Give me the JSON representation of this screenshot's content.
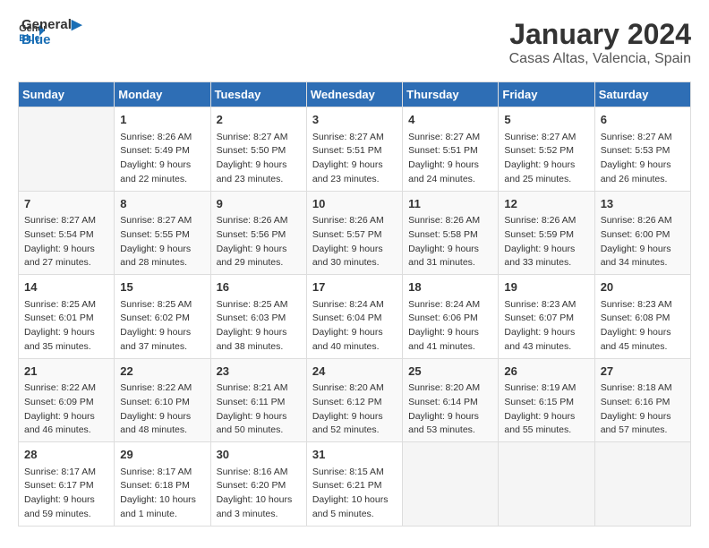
{
  "header": {
    "logo_line1": "General",
    "logo_line2": "Blue",
    "month_year": "January 2024",
    "location": "Casas Altas, Valencia, Spain"
  },
  "weekdays": [
    "Sunday",
    "Monday",
    "Tuesday",
    "Wednesday",
    "Thursday",
    "Friday",
    "Saturday"
  ],
  "weeks": [
    [
      {
        "day": "",
        "info": ""
      },
      {
        "day": "1",
        "info": "Sunrise: 8:26 AM\nSunset: 5:49 PM\nDaylight: 9 hours\nand 22 minutes."
      },
      {
        "day": "2",
        "info": "Sunrise: 8:27 AM\nSunset: 5:50 PM\nDaylight: 9 hours\nand 23 minutes."
      },
      {
        "day": "3",
        "info": "Sunrise: 8:27 AM\nSunset: 5:51 PM\nDaylight: 9 hours\nand 23 minutes."
      },
      {
        "day": "4",
        "info": "Sunrise: 8:27 AM\nSunset: 5:51 PM\nDaylight: 9 hours\nand 24 minutes."
      },
      {
        "day": "5",
        "info": "Sunrise: 8:27 AM\nSunset: 5:52 PM\nDaylight: 9 hours\nand 25 minutes."
      },
      {
        "day": "6",
        "info": "Sunrise: 8:27 AM\nSunset: 5:53 PM\nDaylight: 9 hours\nand 26 minutes."
      }
    ],
    [
      {
        "day": "7",
        "info": "Sunrise: 8:27 AM\nSunset: 5:54 PM\nDaylight: 9 hours\nand 27 minutes."
      },
      {
        "day": "8",
        "info": "Sunrise: 8:27 AM\nSunset: 5:55 PM\nDaylight: 9 hours\nand 28 minutes."
      },
      {
        "day": "9",
        "info": "Sunrise: 8:26 AM\nSunset: 5:56 PM\nDaylight: 9 hours\nand 29 minutes."
      },
      {
        "day": "10",
        "info": "Sunrise: 8:26 AM\nSunset: 5:57 PM\nDaylight: 9 hours\nand 30 minutes."
      },
      {
        "day": "11",
        "info": "Sunrise: 8:26 AM\nSunset: 5:58 PM\nDaylight: 9 hours\nand 31 minutes."
      },
      {
        "day": "12",
        "info": "Sunrise: 8:26 AM\nSunset: 5:59 PM\nDaylight: 9 hours\nand 33 minutes."
      },
      {
        "day": "13",
        "info": "Sunrise: 8:26 AM\nSunset: 6:00 PM\nDaylight: 9 hours\nand 34 minutes."
      }
    ],
    [
      {
        "day": "14",
        "info": "Sunrise: 8:25 AM\nSunset: 6:01 PM\nDaylight: 9 hours\nand 35 minutes."
      },
      {
        "day": "15",
        "info": "Sunrise: 8:25 AM\nSunset: 6:02 PM\nDaylight: 9 hours\nand 37 minutes."
      },
      {
        "day": "16",
        "info": "Sunrise: 8:25 AM\nSunset: 6:03 PM\nDaylight: 9 hours\nand 38 minutes."
      },
      {
        "day": "17",
        "info": "Sunrise: 8:24 AM\nSunset: 6:04 PM\nDaylight: 9 hours\nand 40 minutes."
      },
      {
        "day": "18",
        "info": "Sunrise: 8:24 AM\nSunset: 6:06 PM\nDaylight: 9 hours\nand 41 minutes."
      },
      {
        "day": "19",
        "info": "Sunrise: 8:23 AM\nSunset: 6:07 PM\nDaylight: 9 hours\nand 43 minutes."
      },
      {
        "day": "20",
        "info": "Sunrise: 8:23 AM\nSunset: 6:08 PM\nDaylight: 9 hours\nand 45 minutes."
      }
    ],
    [
      {
        "day": "21",
        "info": "Sunrise: 8:22 AM\nSunset: 6:09 PM\nDaylight: 9 hours\nand 46 minutes."
      },
      {
        "day": "22",
        "info": "Sunrise: 8:22 AM\nSunset: 6:10 PM\nDaylight: 9 hours\nand 48 minutes."
      },
      {
        "day": "23",
        "info": "Sunrise: 8:21 AM\nSunset: 6:11 PM\nDaylight: 9 hours\nand 50 minutes."
      },
      {
        "day": "24",
        "info": "Sunrise: 8:20 AM\nSunset: 6:12 PM\nDaylight: 9 hours\nand 52 minutes."
      },
      {
        "day": "25",
        "info": "Sunrise: 8:20 AM\nSunset: 6:14 PM\nDaylight: 9 hours\nand 53 minutes."
      },
      {
        "day": "26",
        "info": "Sunrise: 8:19 AM\nSunset: 6:15 PM\nDaylight: 9 hours\nand 55 minutes."
      },
      {
        "day": "27",
        "info": "Sunrise: 8:18 AM\nSunset: 6:16 PM\nDaylight: 9 hours\nand 57 minutes."
      }
    ],
    [
      {
        "day": "28",
        "info": "Sunrise: 8:17 AM\nSunset: 6:17 PM\nDaylight: 9 hours\nand 59 minutes."
      },
      {
        "day": "29",
        "info": "Sunrise: 8:17 AM\nSunset: 6:18 PM\nDaylight: 10 hours\nand 1 minute."
      },
      {
        "day": "30",
        "info": "Sunrise: 8:16 AM\nSunset: 6:20 PM\nDaylight: 10 hours\nand 3 minutes."
      },
      {
        "day": "31",
        "info": "Sunrise: 8:15 AM\nSunset: 6:21 PM\nDaylight: 10 hours\nand 5 minutes."
      },
      {
        "day": "",
        "info": ""
      },
      {
        "day": "",
        "info": ""
      },
      {
        "day": "",
        "info": ""
      }
    ]
  ]
}
